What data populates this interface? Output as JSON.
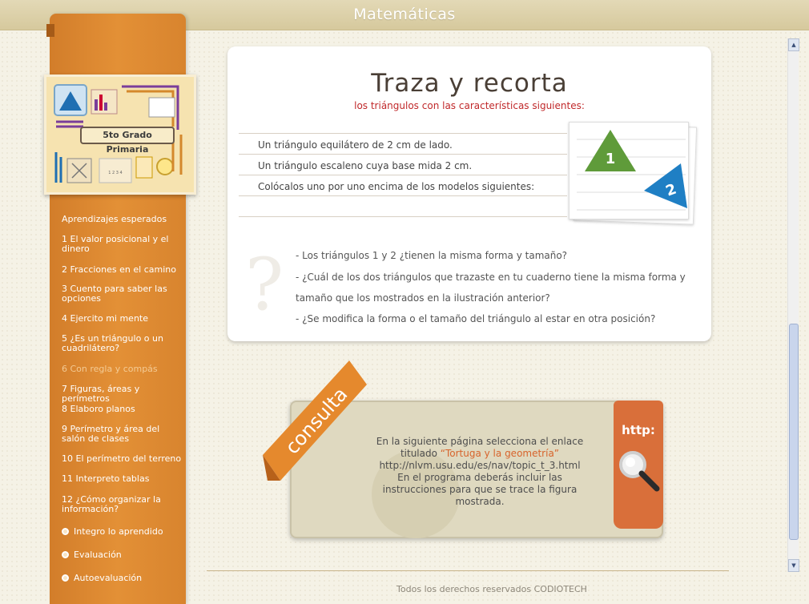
{
  "header": {
    "title": "Matemáticas"
  },
  "cover": {
    "label": "5to Grado Primaria"
  },
  "sidebar": {
    "items": [
      {
        "label": "Aprendizajes esperados"
      },
      {
        "label": "1 El valor posicional y el dinero"
      },
      {
        "label": "2 Fracciones en el camino"
      },
      {
        "label": "3 Cuento para saber las opciones"
      },
      {
        "label": "4 Ejercito mi mente"
      },
      {
        "label": "5 ¿Es un triángulo o un cuadrilátero?"
      },
      {
        "label": "6 Con regla y compás"
      },
      {
        "label": "7 Figuras, áreas y perímetros"
      },
      {
        "label": "8 Elaboro planos"
      },
      {
        "label": "9 Perímetro y área del salón de clases"
      },
      {
        "label": "10 El perímetro del terreno"
      },
      {
        "label": "11 Interpreto tablas"
      },
      {
        "label": "12 ¿Cómo organizar la información?"
      },
      {
        "label": "Integro lo aprendido"
      },
      {
        "label": "Evaluación"
      },
      {
        "label": "Autoevaluación"
      }
    ]
  },
  "activity": {
    "title": "Traza y recorta",
    "subtitle": "los triángulos con las características siguientes:",
    "instructions": [
      "Un triángulo equilátero de 2 cm de lado.",
      "Un triángulo escaleno cuya base mida 2 cm.",
      "Colócalos uno por uno encima de los modelos siguientes:"
    ],
    "figure_labels": [
      "1",
      "2"
    ],
    "questions": [
      "- Los triángulos 1 y 2 ¿tienen la misma forma y tamaño?",
      "- ¿Cuál de los dos triángulos que trazaste en tu cuaderno tiene la misma forma y",
      "tamaño que los mostrados en la ilustración anterior?",
      "- ¿Se modifica la forma o el tamaño del triángulo al estar en otra posición?"
    ]
  },
  "consulta": {
    "ribbon_label": "consulta",
    "http_label": "http:",
    "line1": "En la siguiente página selecciona el enlace",
    "line2_prefix": "titulado ",
    "link_text": "“Tortuga y la geometría”",
    "url": "http://nlvm.usu.edu/es/nav/topic_t_3.html",
    "line4": "En el programa deberás incluir las",
    "line5": "instrucciones para que se trace la figura",
    "line6": "mostrada."
  },
  "footer": {
    "text": "Todos los derechos reservados CODIOTECH"
  },
  "colors": {
    "accent_orange": "#e08c34",
    "title_red": "#c0282a",
    "triangle_green": "#5f9b3a",
    "triangle_blue": "#1f7fc4"
  }
}
